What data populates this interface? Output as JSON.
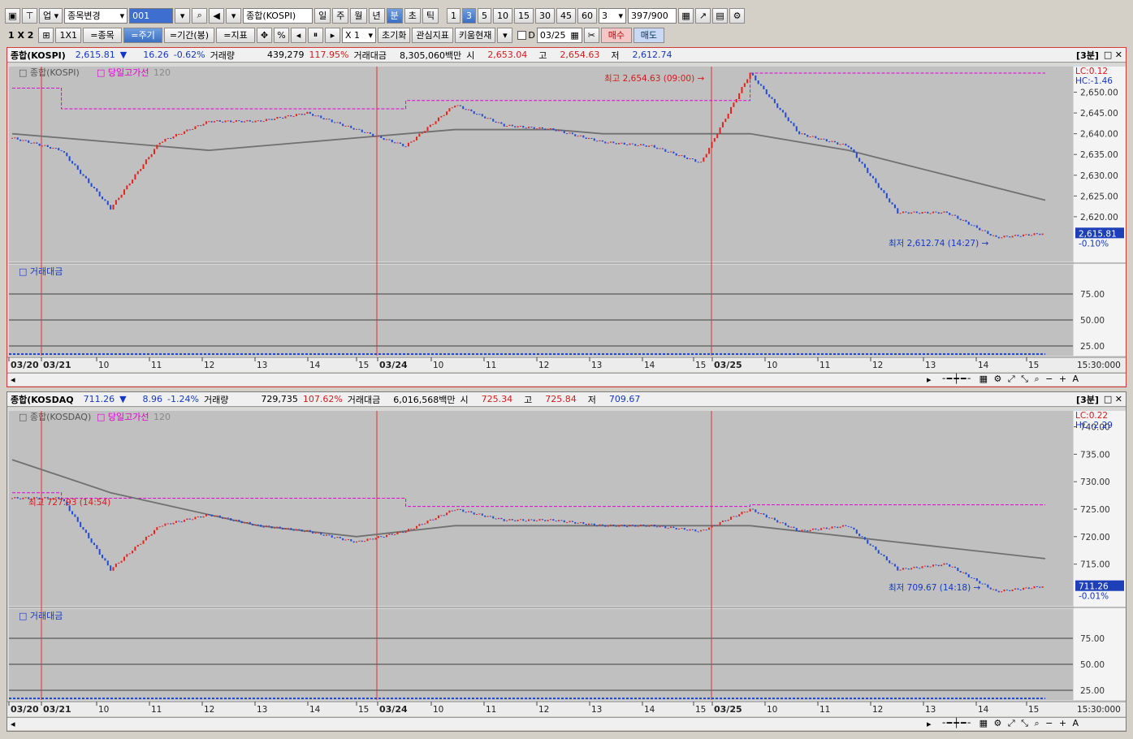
{
  "toolbar1": {
    "market": "업",
    "change_code": "종목변경",
    "code": "001",
    "symbol": "종합(KOSPI)",
    "periods": [
      "일",
      "주",
      "월",
      "년",
      "분",
      "초",
      "틱"
    ],
    "active_period": "분",
    "intervals": [
      "1",
      "3",
      "5",
      "10",
      "15",
      "30",
      "45",
      "60"
    ],
    "active_interval": "3",
    "interval_value": "3",
    "count": "397",
    "count_max": "/900"
  },
  "toolbar2": {
    "layout": "1 X 2",
    "one_by_one": "1X1",
    "btn_symbol": "=종목",
    "btn_period": "=주기",
    "btn_range": "=기간(봉)",
    "btn_indicator": "=지표",
    "multiplier": "X 1",
    "reset": "초기화",
    "favorite": "관심지표",
    "kiwoom": "키움현재",
    "date_prefix": "D",
    "date": "03/25",
    "buy": "매수",
    "sell": "매도"
  },
  "colors": {
    "up": "#e8201b",
    "down": "#1f49d6",
    "ma": "#707070",
    "high_line": "#e100d6",
    "active_border": "#d23a3a",
    "chart_bg": "#c0c0c0"
  },
  "panes": [
    {
      "name": "종합(KOSPI)",
      "price": "2,615.81",
      "arrow": "▼",
      "change": "16.26",
      "change_pct": "-0.62%",
      "volume_label": "거래량",
      "volume": "439,279",
      "volume_pct": "117.95%",
      "amount_label": "거래대금",
      "amount": "8,305,060백만",
      "open_label": "시",
      "open": "2,653.04",
      "high_label": "고",
      "high": "2,654.63",
      "low_label": "저",
      "low": "2,612.74",
      "period_tag": "[3분]",
      "legend": "종합(KOSPI)",
      "legend2": "당일고가선",
      "legend3": "120",
      "lc": "LC:0.12",
      "hc": "HC:-1.46",
      "last_price": "2,615.81",
      "last_pct": "-0.10%",
      "high_annot": "최고 2,654.63 (09:00)",
      "low_annot": "최저 2,612.74 (14:27)",
      "sub_title": "거래대금",
      "sub_ticks": [
        "75.00",
        "50.00",
        "25.00"
      ],
      "y_ticks": [
        "2,650.00",
        "2,645.00",
        "2,640.00",
        "2,635.00",
        "2,630.00",
        "2,625.00",
        "2,620.00"
      ],
      "time_labels": [
        "03/20",
        "03/21",
        "10",
        "11",
        "12",
        "13",
        "14",
        "15",
        "03/24",
        "10",
        "11",
        "12",
        "13",
        "14",
        "15",
        "03/25",
        "10",
        "11",
        "12",
        "13",
        "14",
        "15"
      ],
      "time_end": "15:30:000"
    },
    {
      "name": "종합(KOSDAQ",
      "price": "711.26",
      "arrow": "▼",
      "change": "8.96",
      "change_pct": "-1.24%",
      "volume_label": "거래량",
      "volume": "729,735",
      "volume_pct": "107.62%",
      "amount_label": "거래대금",
      "amount": "6,016,568백만",
      "open_label": "시",
      "open": "725.34",
      "high_label": "고",
      "high": "725.84",
      "low_label": "저",
      "low": "709.67",
      "period_tag": "[3분]",
      "legend": "종합(KOSDAQ)",
      "legend2": "당일고가선",
      "legend3": "120",
      "lc": "LC:0.22",
      "hc": "HC:-2.29",
      "last_price": "711.26",
      "last_pct": "-0.01%",
      "high_annot": "최고 727.93 (14:54)",
      "low_annot": "최저 709.67 (14:18)",
      "sub_title": "거래대금",
      "sub_ticks": [
        "75.00",
        "50.00",
        "25.00"
      ],
      "y_ticks": [
        "740.00",
        "735.00",
        "730.00",
        "725.00",
        "720.00",
        "715.00"
      ],
      "time_labels": [
        "03/20",
        "03/21",
        "10",
        "11",
        "12",
        "13",
        "14",
        "15",
        "03/24",
        "10",
        "11",
        "12",
        "13",
        "14",
        "15",
        "03/25",
        "10",
        "11",
        "12",
        "13",
        "14",
        "15"
      ],
      "time_end": "15:30:000"
    }
  ],
  "chart_data": [
    {
      "type": "line",
      "title": "종합(KOSPI)",
      "ylim": [
        2610,
        2655
      ],
      "x": [
        "03/20",
        "03/21 09",
        "03/21 10",
        "03/21 11",
        "03/21 12",
        "03/21 13",
        "03/21 14",
        "03/21 15",
        "03/24 09",
        "03/24 10",
        "03/24 11",
        "03/24 12",
        "03/24 13",
        "03/24 14",
        "03/24 15",
        "03/25 09",
        "03/25 10",
        "03/25 11",
        "03/25 12",
        "03/25 13",
        "03/25 14",
        "03/25 15"
      ],
      "series": [
        {
          "name": "종합(KOSPI)",
          "values": [
            2639,
            2636,
            2622,
            2638,
            2643,
            2643,
            2645,
            2641,
            2637,
            2647,
            2642,
            2641,
            2638,
            2637,
            2633,
            2654.6,
            2640,
            2637,
            2621,
            2621,
            2615,
            2616
          ]
        },
        {
          "name": "120",
          "values": [
            2640,
            2639,
            2638,
            2637,
            2636,
            2637,
            2638,
            2639,
            2640,
            2641,
            2641,
            2641,
            2640,
            2640,
            2640,
            2640,
            2638,
            2636,
            2633,
            2630,
            2627,
            2624
          ]
        },
        {
          "name": "당일고가선",
          "values": [
            2651,
            2646,
            2646,
            2646,
            2646,
            2646,
            2646,
            2646,
            2648,
            2648,
            2648,
            2648,
            2648,
            2648,
            2648,
            2654.6,
            2654.6,
            2654.6,
            2654.6,
            2654.6,
            2654.6,
            2654.6
          ]
        }
      ]
    },
    {
      "type": "line",
      "title": "종합(KOSDAQ)",
      "ylim": [
        708,
        742
      ],
      "x": [
        "03/20",
        "03/21 09",
        "03/21 10",
        "03/21 11",
        "03/21 12",
        "03/21 13",
        "03/21 14",
        "03/21 15",
        "03/24 09",
        "03/24 10",
        "03/24 11",
        "03/24 12",
        "03/24 13",
        "03/24 14",
        "03/24 15",
        "03/25 09",
        "03/25 10",
        "03/25 11",
        "03/25 12",
        "03/25 13",
        "03/25 14",
        "03/25 15"
      ],
      "series": [
        {
          "name": "종합(KOSDAQ)",
          "values": [
            727,
            727,
            714,
            722,
            724,
            722,
            721,
            719,
            721,
            725,
            723,
            723,
            722,
            722,
            721,
            725,
            721,
            722,
            714,
            715,
            710,
            711
          ]
        },
        {
          "name": "120",
          "values": [
            734,
            731,
            728,
            726,
            724,
            722,
            721,
            720,
            721,
            722,
            722,
            722,
            722,
            722,
            722,
            722,
            721,
            720,
            719,
            718,
            717,
            716
          ]
        },
        {
          "name": "당일고가선",
          "values": [
            728,
            727,
            727,
            727,
            727,
            727,
            727,
            727,
            725.5,
            725.5,
            725.5,
            725.5,
            725.5,
            725.5,
            725.5,
            725.8,
            725.8,
            725.8,
            725.8,
            725.8,
            725.8,
            725.8
          ]
        }
      ]
    }
  ]
}
